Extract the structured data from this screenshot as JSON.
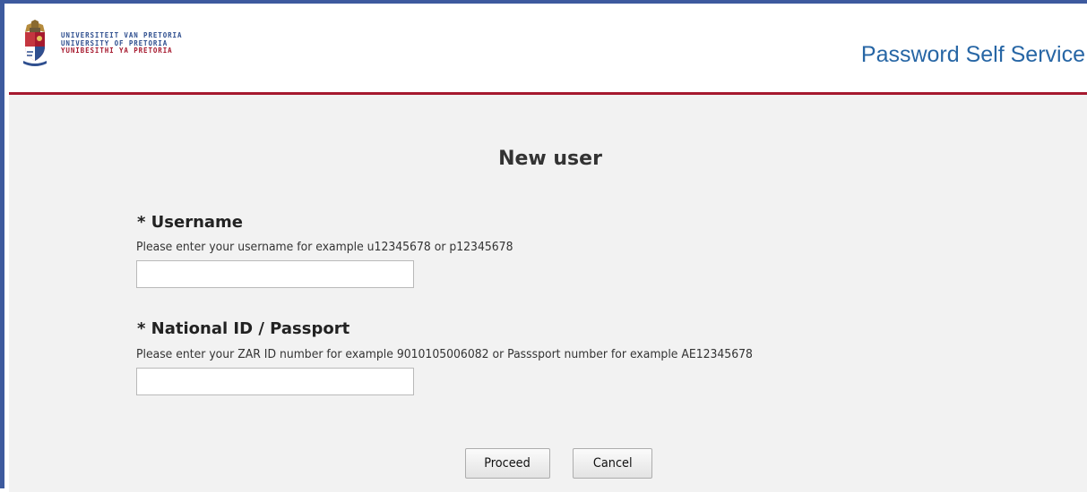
{
  "header": {
    "logo_lines": [
      "UNIVERSITEIT VAN PRETORIA",
      "UNIVERSITY OF PRETORIA",
      "YUNIBESITHI YA PRETORIA"
    ],
    "app_title": "Password Self Service"
  },
  "main": {
    "page_title": "New user",
    "username": {
      "label": "* Username",
      "help": "Please enter your username for example u12345678 or p12345678",
      "value": "",
      "placeholder": ""
    },
    "national_id": {
      "label": "* National ID / Passport",
      "help": "Please enter your ZAR ID number for example 9010105006082 or Passsport number for example AE12345678",
      "value": "",
      "placeholder": ""
    },
    "buttons": {
      "proceed": "Proceed",
      "cancel": "Cancel"
    }
  },
  "colors": {
    "frame_border": "#3d5a9e",
    "header_rule": "#a6192e",
    "title_blue": "#2766a5",
    "content_bg": "#f2f2f2"
  },
  "icons": {
    "logo": "university-crest-icon"
  }
}
